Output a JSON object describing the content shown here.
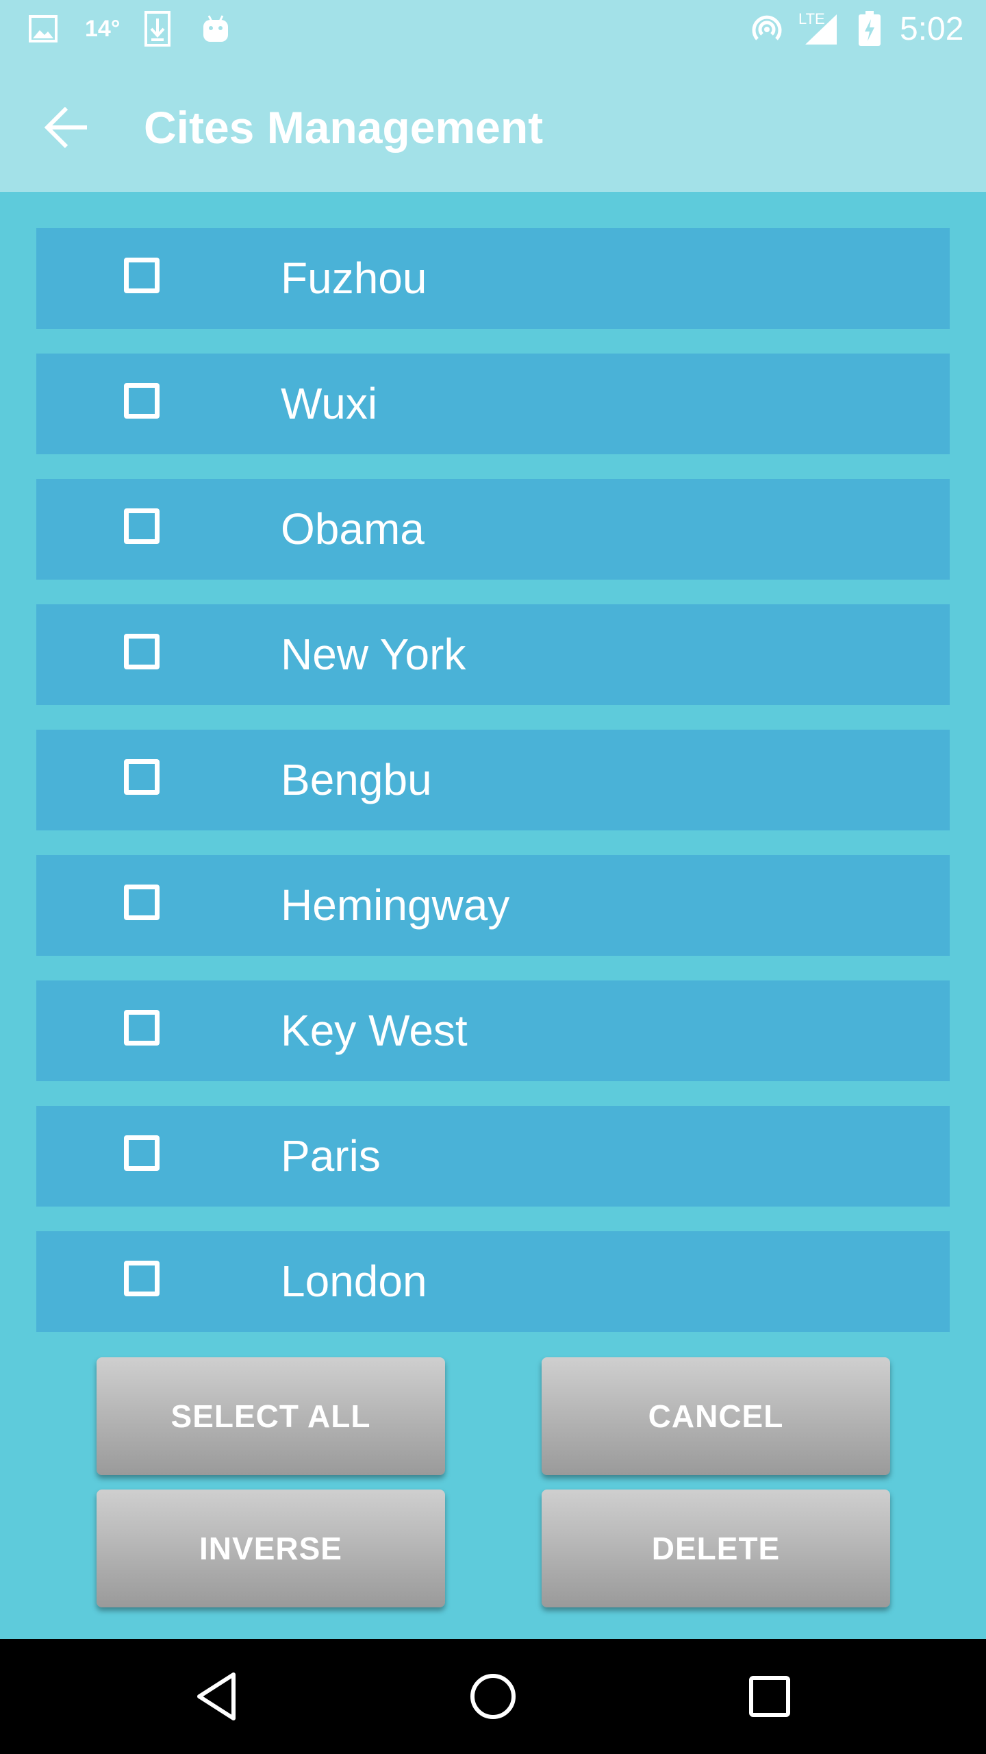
{
  "status_bar": {
    "temperature": "14°",
    "network_label": "LTE",
    "time": "5:02",
    "icons": [
      "image-icon",
      "download-icon",
      "android-icon",
      "hotspot-icon",
      "signal-icon",
      "battery-charging-icon"
    ]
  },
  "toolbar": {
    "title": "Cites Management",
    "back_icon": "arrow-back-icon"
  },
  "cities": [
    {
      "name": "Fuzhou",
      "checked": false
    },
    {
      "name": "Wuxi",
      "checked": false
    },
    {
      "name": "Obama",
      "checked": false
    },
    {
      "name": "New York",
      "checked": false
    },
    {
      "name": "Bengbu",
      "checked": false
    },
    {
      "name": "Hemingway",
      "checked": false
    },
    {
      "name": "Key West",
      "checked": false
    },
    {
      "name": "Paris",
      "checked": false
    },
    {
      "name": "London",
      "checked": false
    }
  ],
  "actions": {
    "select_all": "SELECT ALL",
    "cancel": "CANCEL",
    "inverse": "INVERSE",
    "delete": "DELETE"
  },
  "nav_bar": {
    "icons": [
      "back-triangle-icon",
      "home-circle-icon",
      "recents-square-icon"
    ]
  },
  "colors": {
    "app_bar": "#a3e1e8",
    "background": "#5ecbdb",
    "list_item": "#4ab2d7",
    "button": "#b4b4b4",
    "text": "#ffffff"
  }
}
